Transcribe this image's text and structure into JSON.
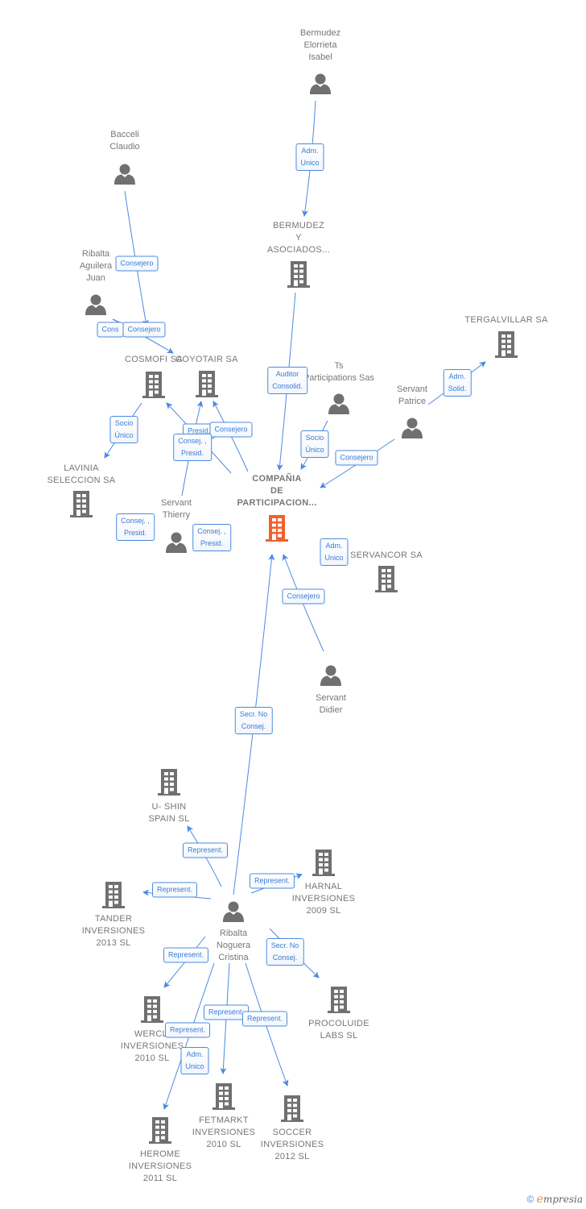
{
  "colors": {
    "edge": "#4a8ae0",
    "node": "#707070",
    "main_node": "#f2612b"
  },
  "nodes": [
    {
      "type": "person",
      "lines": [
        "Bermudez",
        "Elorrieta",
        "Isabel"
      ]
    },
    {
      "type": "person",
      "lines": [
        "Bacceli",
        "Claudio"
      ]
    },
    {
      "type": "person",
      "lines": [
        "Ribalta",
        "Aguilera",
        "Juan"
      ]
    },
    {
      "type": "company",
      "lines": [
        "BERMUDEZ",
        "Y",
        "ASOCIADOS..."
      ]
    },
    {
      "type": "company",
      "lines": [
        "COSMOFI SA"
      ]
    },
    {
      "type": "company",
      "lines": [
        "COYOTAIR SA"
      ]
    },
    {
      "type": "company",
      "lines": [
        "LAVINIA",
        "SELECCION SA"
      ]
    },
    {
      "type": "person",
      "lines": [
        "Servant",
        "Thierry"
      ]
    },
    {
      "type": "main",
      "lines": [
        "COMPAÑIA",
        "DE",
        "PARTICIPACION..."
      ]
    },
    {
      "type": "person",
      "lines": [
        "Ts",
        "Participations Sas"
      ]
    },
    {
      "type": "person",
      "lines": [
        "Servant",
        "Patrice"
      ]
    },
    {
      "type": "company",
      "lines": [
        "TERGALVILLAR SA"
      ]
    },
    {
      "type": "company",
      "lines": [
        "SERVANCOR SA"
      ]
    },
    {
      "type": "person",
      "lines": [
        "Servant",
        "Didier"
      ]
    },
    {
      "type": "company",
      "lines": [
        "U- SHIN",
        "SPAIN  SL"
      ]
    },
    {
      "type": "company",
      "lines": [
        "HARNAL",
        "INVERSIONES",
        "2009 SL"
      ]
    },
    {
      "type": "company",
      "lines": [
        "TANDER",
        "INVERSIONES",
        "2013 SL"
      ]
    },
    {
      "type": "person",
      "lines": [
        "Ribalta",
        "Noguera",
        "Cristina"
      ]
    },
    {
      "type": "company",
      "lines": [
        "WERCLI",
        "INVERSIONES",
        "2010 SL"
      ]
    },
    {
      "type": "company",
      "lines": [
        "PROCOLUIDE",
        "LABS SL"
      ]
    },
    {
      "type": "company",
      "lines": [
        "FETMARKT",
        "INVERSIONES",
        "2010 SL"
      ]
    },
    {
      "type": "company",
      "lines": [
        "SOCCER",
        "INVERSIONES",
        "2012 SL"
      ]
    },
    {
      "type": "company",
      "lines": [
        "HEROME",
        "INVERSIONES",
        "2011 SL"
      ]
    }
  ],
  "edge_labels": [
    [
      "Adm.",
      "Unico"
    ],
    [
      "Consejero"
    ],
    [
      "Cons"
    ],
    [
      "Consejero"
    ],
    [
      "Auditor",
      "Consolid."
    ],
    [
      "Socio",
      "Único"
    ],
    [
      "Presid."
    ],
    [
      "Consejero"
    ],
    [
      "Consej. ,",
      "Presid."
    ],
    [
      "Adm.",
      "Solid."
    ],
    [
      "Socio",
      "Único"
    ],
    [
      "Consejero"
    ],
    [
      "Consej. ,",
      "Presid."
    ],
    [
      "Consej. ,",
      "Presid."
    ],
    [
      "Adm.",
      "Unico"
    ],
    [
      "Consejero"
    ],
    [
      "Secr.  No",
      "Consej."
    ],
    [
      "Represent."
    ],
    [
      "Represent."
    ],
    [
      "Represent."
    ],
    [
      "Represent."
    ],
    [
      "Secr.  No",
      "Consej."
    ],
    [
      "Represent."
    ],
    [
      "Represent."
    ],
    [
      "Represent."
    ],
    [
      "Adm.",
      "Unico"
    ]
  ],
  "footer": {
    "copyright": "©",
    "brand_initial": "e",
    "brand_rest": "mpresia"
  }
}
